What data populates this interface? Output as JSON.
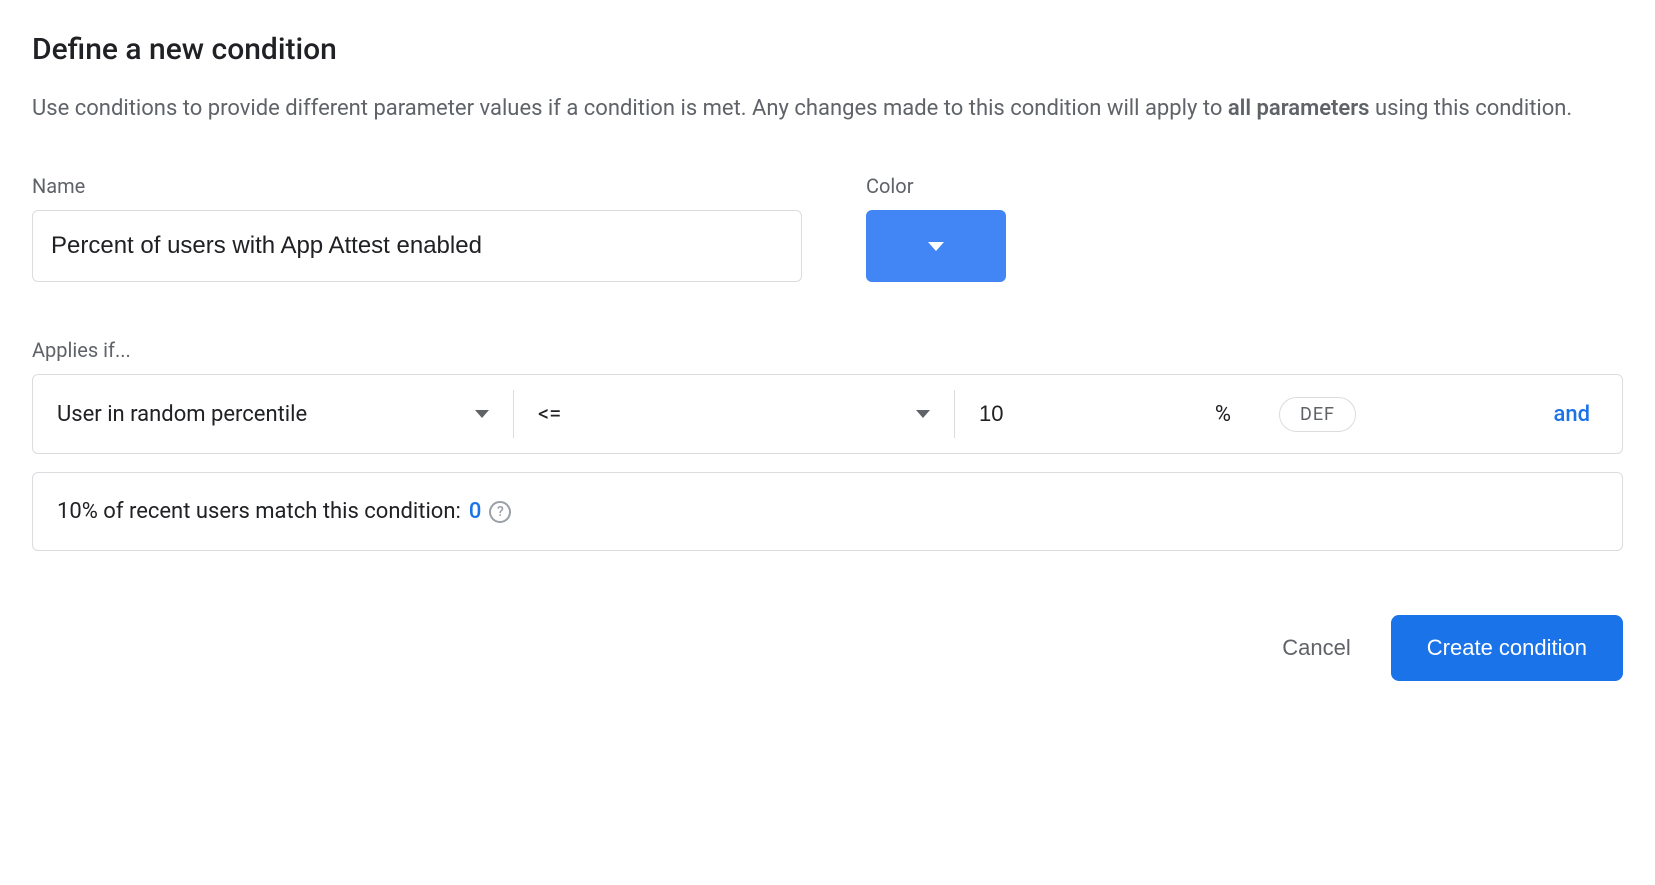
{
  "title": "Define a new condition",
  "description": {
    "pre": "Use conditions to provide different parameter values if a condition is met. Any changes made to this condition will apply to ",
    "bold": "all parameters",
    "post": " using this condition."
  },
  "fields": {
    "name_label": "Name",
    "name_value": "Percent of users with App Attest enabled",
    "color_label": "Color",
    "color_value": "#4285f4"
  },
  "applies_label": "Applies if...",
  "condition": {
    "target": "User in random percentile",
    "operator": "<=",
    "value": "10",
    "unit": "%",
    "chip": "DEF",
    "add_label": "and"
  },
  "match": {
    "text": "10% of recent users match this condition: ",
    "count": "0"
  },
  "footer": {
    "cancel": "Cancel",
    "create": "Create condition"
  }
}
